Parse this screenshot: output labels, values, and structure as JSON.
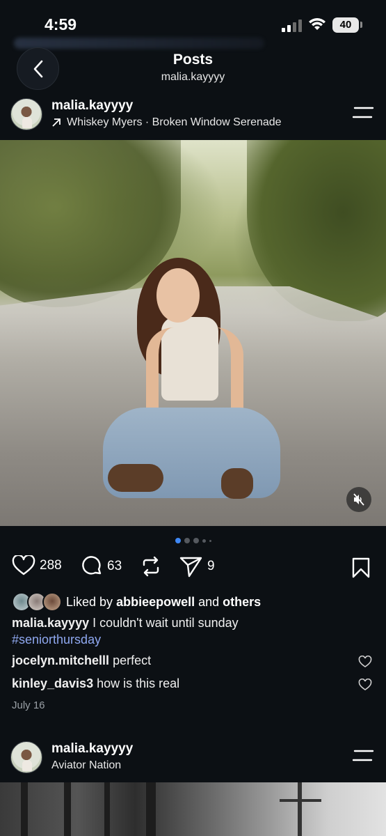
{
  "status_bar": {
    "time": "4:59",
    "battery": "40"
  },
  "header": {
    "title": "Posts",
    "subtitle": "malia.kayyyy"
  },
  "post1": {
    "username": "malia.kayyyy",
    "music": "Whiskey Myers · Broken Window Serenade",
    "likes": "288",
    "comments": "63",
    "shares": "9",
    "liked_by_prefix": "Liked by",
    "liked_by_user": "abbieepowell",
    "liked_by_and": "and",
    "liked_by_others": "others",
    "caption_user": "malia.kayyyy",
    "caption_text": "I couldn't wait until sunday",
    "hashtag": "#seniorthursday",
    "comment_list": [
      {
        "user": "jocelyn.mitchelll",
        "text": "perfect"
      },
      {
        "user": "kinley_davis3",
        "text": "how is this real"
      }
    ],
    "date": "July 16",
    "carousel_count": 5,
    "carousel_active": 1
  },
  "post2": {
    "username": "malia.kayyyy",
    "location": "Aviator Nation"
  },
  "colors": {
    "background": "#0c1014",
    "accent": "#3f88f5",
    "hashtag": "#8fa8f0"
  }
}
